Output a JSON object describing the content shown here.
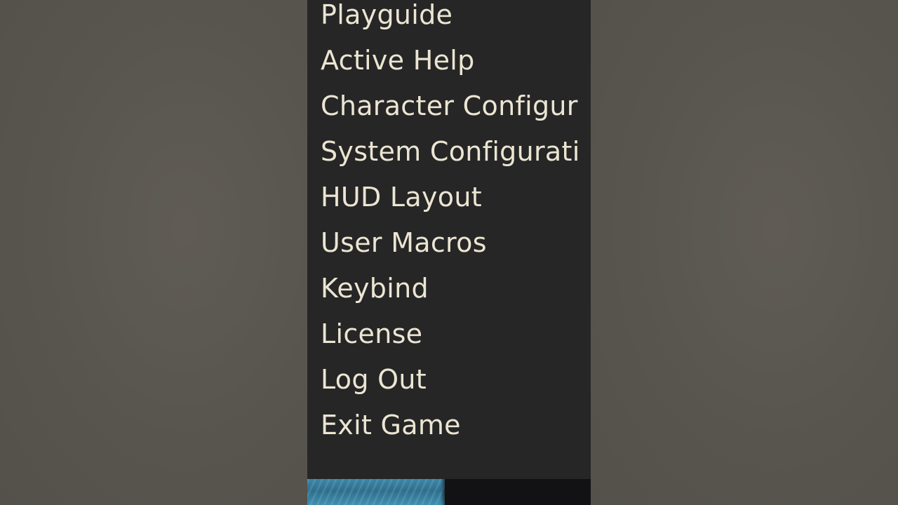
{
  "menu": {
    "items": [
      {
        "label": "Playguide"
      },
      {
        "label": "Active Help"
      },
      {
        "label": "Character Configur"
      },
      {
        "label": "System Configurati"
      },
      {
        "label": "HUD Layout"
      },
      {
        "label": "User Macros"
      },
      {
        "label": "Keybind"
      },
      {
        "label": "License"
      },
      {
        "label": "Log Out"
      },
      {
        "label": "Exit Game"
      }
    ]
  },
  "colors": {
    "panel_background": "#262627",
    "menu_text": "#ebe5d2",
    "side_background": "#5a5751",
    "scene_water": "#3c86a8"
  }
}
